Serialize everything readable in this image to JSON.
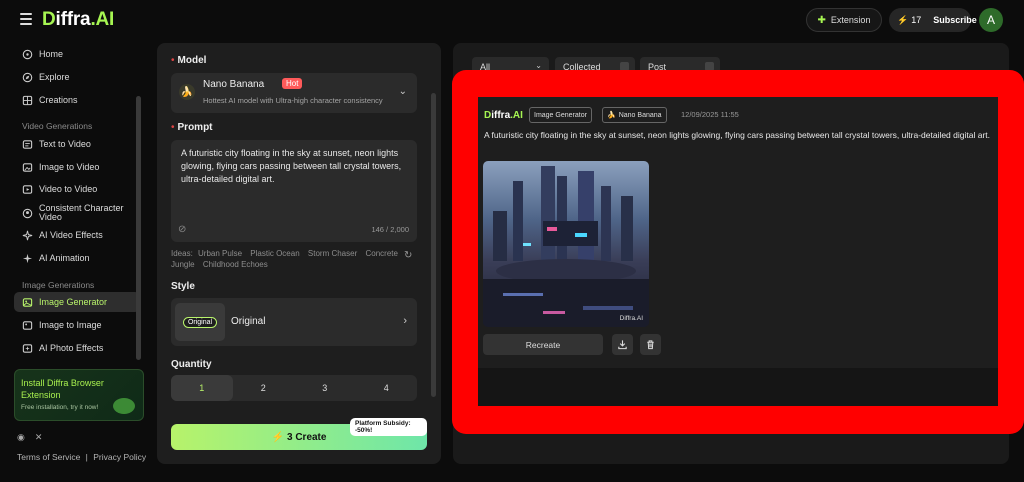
{
  "app": {
    "logo_prefix": "D",
    "logo_rest": "iffra",
    "logo_suffix": ".AI"
  },
  "topbar": {
    "extension_label": "Extension",
    "credits": "17",
    "subscribe_label": "Subscribe",
    "avatar_initial": "A"
  },
  "sidebar": {
    "main_items": [
      {
        "label": "Home",
        "icon": "home-icon"
      },
      {
        "label": "Explore",
        "icon": "compass-icon"
      },
      {
        "label": "Creations",
        "icon": "grid-icon"
      }
    ],
    "video_section_title": "Video  Generations",
    "video_items": [
      {
        "label": "Text to Video",
        "icon": "text-video-icon"
      },
      {
        "label": "Image to Video",
        "icon": "image-video-icon"
      },
      {
        "label": "Video to Video",
        "icon": "video-video-icon"
      },
      {
        "label": "Consistent Character Video",
        "icon": "character-icon"
      },
      {
        "label": "AI Video Effects",
        "icon": "sparkle-icon"
      },
      {
        "label": "AI Animation",
        "icon": "animation-icon"
      }
    ],
    "image_section_title": "Image  Generations",
    "image_items": [
      {
        "label": "Image Generator",
        "icon": "image-icon",
        "active": true
      },
      {
        "label": "Image to Image",
        "icon": "image-image-icon"
      },
      {
        "label": "AI Photo Effects",
        "icon": "photo-effects-icon"
      }
    ],
    "promo": {
      "title": "Install Diffra Browser Extension",
      "subtitle": "Free installation, try it now!"
    },
    "footer": {
      "terms": "Terms of Service",
      "divider": "|",
      "privacy": "Privacy Policy"
    }
  },
  "form": {
    "model_label": "Model",
    "model_name": "Nano Banana",
    "model_badge": "Hot",
    "model_desc": "Hottest AI model with Ultra-high character consistency",
    "prompt_label": "Prompt",
    "prompt_text": "A futuristic city floating in the sky at sunset, neon lights glowing, flying cars passing between tall crystal towers, ultra-detailed digital art.",
    "char_count": "146 / 2,000",
    "ideas_prefix": "Ideas:",
    "ideas": [
      "Urban Pulse",
      "Plastic Ocean",
      "Storm Chaser",
      "Concrete Jungle",
      "Childhood Echoes"
    ],
    "style_label": "Style",
    "style_badge": "Original",
    "style_name": "Original",
    "quantity_label": "Quantity",
    "quantities": [
      "1",
      "2",
      "3",
      "4"
    ],
    "quantity_selected": "1",
    "create_label": "3 Create",
    "subsidy": "Platform Subsidy: -50%!"
  },
  "results": {
    "filter_all": "All",
    "filter_collected": "Collected",
    "filter_post": "Post",
    "card": {
      "logo_prefix": "D",
      "logo_rest": "iffra",
      "logo_suffix": ".AI",
      "tag_generator": "Image Generator",
      "tag_model": "Nano Banana",
      "timestamp": "12/09/2025 11:55",
      "prompt": "A futuristic city floating in the sky at sunset, neon lights glowing, flying cars passing between tall crystal towers, ultra-detailed digital art.",
      "watermark": "Diffra.AI",
      "recreate_label": "Recreate"
    }
  },
  "colors": {
    "accent": "#a6f552",
    "highlight_frame": "#ff0000",
    "hot_badge": "#ff5a5a"
  }
}
